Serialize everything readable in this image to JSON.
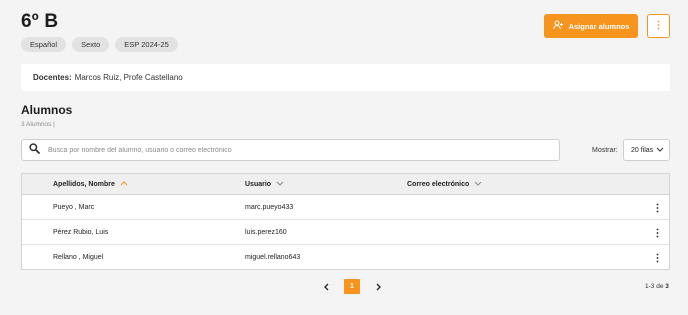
{
  "header": {
    "title": "6º B",
    "tags": [
      "Español",
      "Sexto",
      "ESP 2024-25"
    ],
    "assign_button": "Asignar alumnos"
  },
  "teachers": {
    "label": "Docentes:",
    "value": "Marcos Ruiz, Profe Castellano"
  },
  "students": {
    "title": "Alumnos",
    "count": "3 Alumnos |",
    "search_placeholder": "Busca por nombre del alumno, usuario o correo electrónico",
    "show_label": "Mostrar:",
    "rows_option": "20 filas",
    "columns": [
      "Apellidos, Nombre",
      "Usuario",
      "Correo electrónico"
    ],
    "rows": [
      {
        "name": "Pueyo , Marc",
        "user": "marc.pueyo433",
        "email": ""
      },
      {
        "name": "Pérez Rubio, Luis",
        "user": "luis.perez160",
        "email": ""
      },
      {
        "name": "Rellano , Miguel",
        "user": "miguel.rellano643",
        "email": ""
      }
    ]
  },
  "pagination": {
    "current_page": "1",
    "range_text": "1-3 de",
    "total": "3"
  },
  "colors": {
    "accent": "#f7941d",
    "background": "#f4f4f4"
  },
  "icons": [
    "person-add-icon",
    "more-vertical-icon",
    "search-icon",
    "chevron-down-icon",
    "sort-up-icon",
    "chevron-left-icon",
    "chevron-right-icon"
  ]
}
